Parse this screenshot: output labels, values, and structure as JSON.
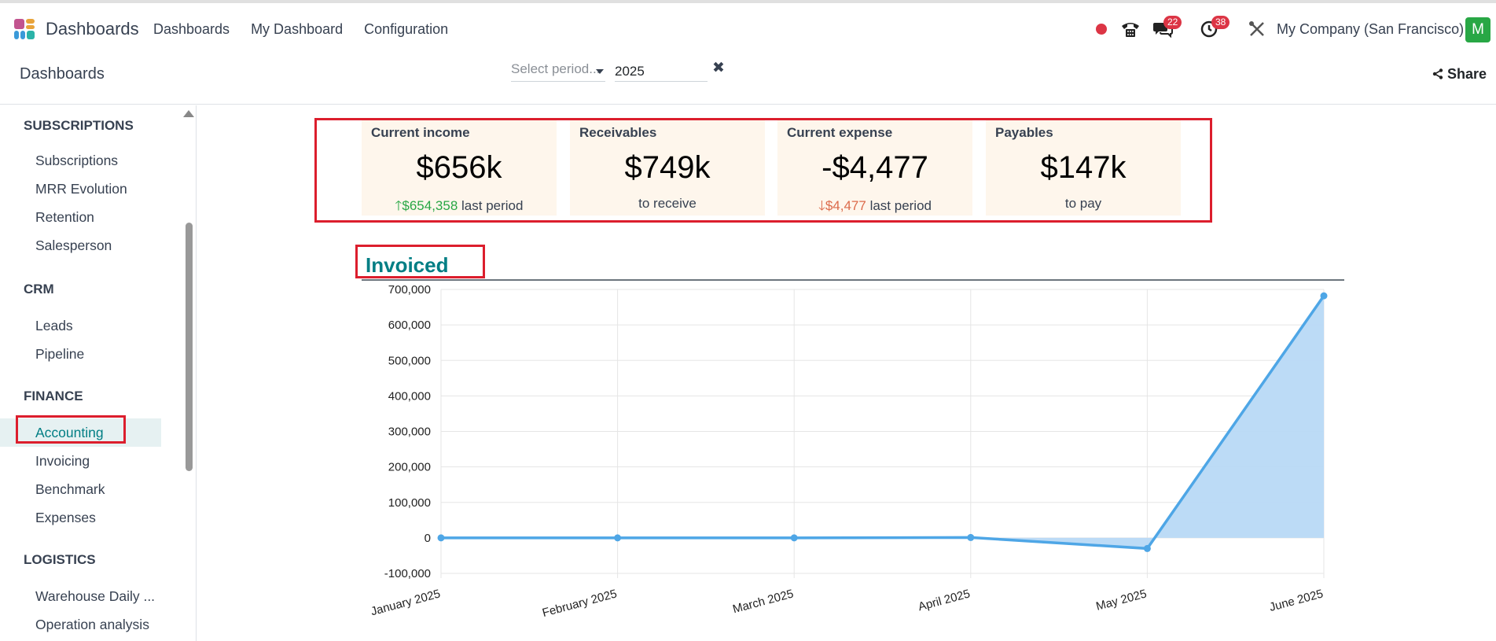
{
  "app": {
    "name": "Dashboards",
    "icon": "dashboards-app-icon"
  },
  "nav": [
    "Dashboards",
    "My Dashboard",
    "Configuration"
  ],
  "systray": {
    "recording_color": "#dc3545",
    "phone_icon": "phone-icon",
    "messages_count": "22",
    "activities_count": "38",
    "tools_icon": "tools-icon",
    "company": "My Company (San Francisco)",
    "avatar_letter": "M"
  },
  "control": {
    "breadcrumb": "Dashboards",
    "period_placeholder": "Select period...",
    "year": "2025",
    "clear_icon": "close-icon",
    "share_label": "Share"
  },
  "sidebar": {
    "sections": [
      {
        "title": "SUBSCRIPTIONS",
        "items": [
          "Subscriptions",
          "MRR Evolution",
          "Retention",
          "Salesperson"
        ]
      },
      {
        "title": "CRM",
        "items": [
          "Leads",
          "Pipeline"
        ]
      },
      {
        "title": "FINANCE",
        "items": [
          "Accounting",
          "Invoicing",
          "Benchmark",
          "Expenses"
        ]
      },
      {
        "title": "LOGISTICS",
        "items": [
          "Warehouse Daily ...",
          "Operation analysis"
        ]
      }
    ],
    "active_item": "Accounting"
  },
  "kpis": [
    {
      "title": "Current income",
      "value": "$656k",
      "trend": "up",
      "delta": "$654,358",
      "sub": "last period"
    },
    {
      "title": "Receivables",
      "value": "$749k",
      "trend": "",
      "delta": "",
      "sub": "to receive"
    },
    {
      "title": "Current expense",
      "value": "-$4,477",
      "trend": "down",
      "delta": "$4,477",
      "sub": "last period"
    },
    {
      "title": "Payables",
      "value": "$147k",
      "trend": "",
      "delta": "",
      "sub": "to pay"
    }
  ],
  "colors": {
    "accent": "#017e84",
    "line": "#4ea6e6",
    "area": "#b8d9f5",
    "highlight": "#dc1e2d",
    "kpi_bg": "#fef6ec"
  },
  "chart_data": {
    "type": "area",
    "title": "Invoiced",
    "x": [
      "January 2025",
      "February 2025",
      "March 2025",
      "April 2025",
      "May 2025",
      "June 2025"
    ],
    "series": [
      {
        "values": [
          0,
          0,
          0,
          1000,
          -30000,
          682000
        ]
      }
    ],
    "ylim": [
      -100000,
      700000
    ],
    "yticks": [
      -100000,
      0,
      100000,
      200000,
      300000,
      400000,
      500000,
      600000,
      700000
    ],
    "ytick_labels": [
      "-100,000",
      "0",
      "100,000",
      "200,000",
      "300,000",
      "400,000",
      "500,000",
      "600,000",
      "700,000"
    ],
    "grid": true,
    "legend": "none"
  }
}
